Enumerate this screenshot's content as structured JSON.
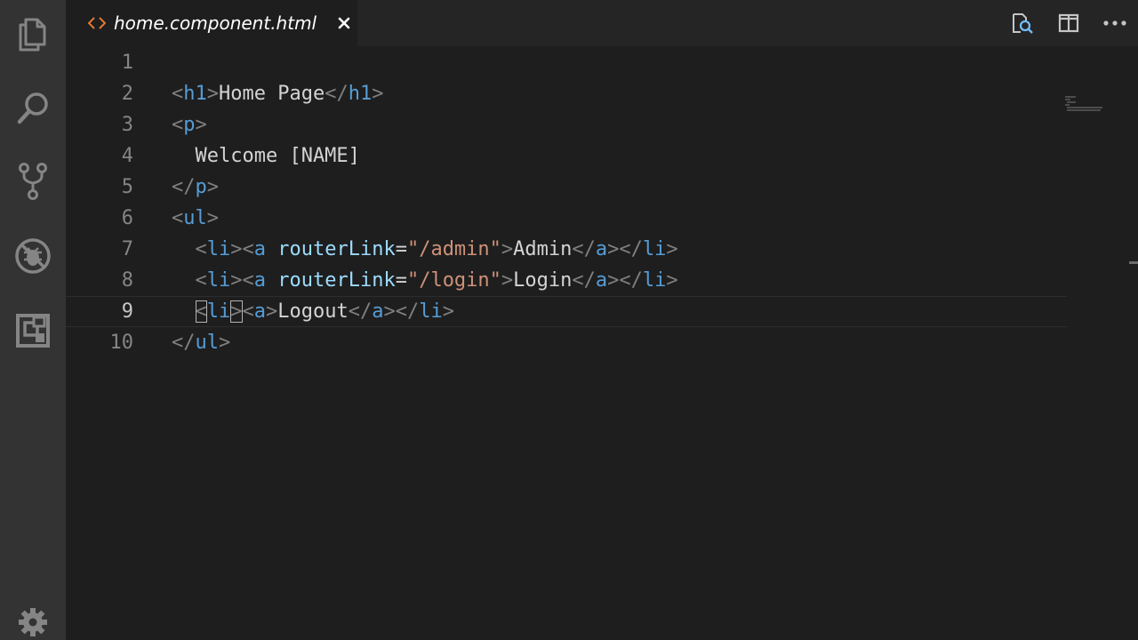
{
  "activity_bar": {
    "items": [
      {
        "name": "explorer",
        "icon": "files-icon"
      },
      {
        "name": "search",
        "icon": "search-icon"
      },
      {
        "name": "source-control",
        "icon": "source-control-icon"
      },
      {
        "name": "debug",
        "icon": "debug-icon"
      },
      {
        "name": "extensions",
        "icon": "extensions-icon"
      }
    ],
    "settings_icon": "gear-icon"
  },
  "tab": {
    "title": "home.component.html",
    "icon": "code-brackets-icon",
    "icon_color": "#e37933",
    "close_icon": "close-icon"
  },
  "editor_actions": [
    {
      "name": "open-preview",
      "icon": "open-preview-icon"
    },
    {
      "name": "split-editor",
      "icon": "split-editor-icon"
    },
    {
      "name": "more-actions",
      "icon": "ellipsis-icon"
    }
  ],
  "editor": {
    "current_line": 9,
    "lines": [
      {
        "number": "1",
        "text": ""
      },
      {
        "number": "2",
        "text": "<h1>Home Page</h1>"
      },
      {
        "number": "3",
        "text": "<p>"
      },
      {
        "number": "4",
        "text": "  Welcome [NAME]"
      },
      {
        "number": "5",
        "text": "</p>"
      },
      {
        "number": "6",
        "text": "<ul>"
      },
      {
        "number": "7",
        "text": "  <li><a routerLink=\"/admin\">Admin</a></li>"
      },
      {
        "number": "8",
        "text": "  <li><a routerLink=\"/login\">Login</a></li>"
      },
      {
        "number": "9",
        "text": "  <li><a>Logout</a></li>"
      },
      {
        "number": "10",
        "text": "</ul>"
      }
    ]
  },
  "colors": {
    "background": "#1e1e1e",
    "activity_bar": "#333333",
    "tag": "#569cd6",
    "attribute": "#9cdcfe",
    "string": "#ce9178",
    "text": "#d4d4d4",
    "punctuation": "#808080",
    "line_number": "#858585"
  }
}
